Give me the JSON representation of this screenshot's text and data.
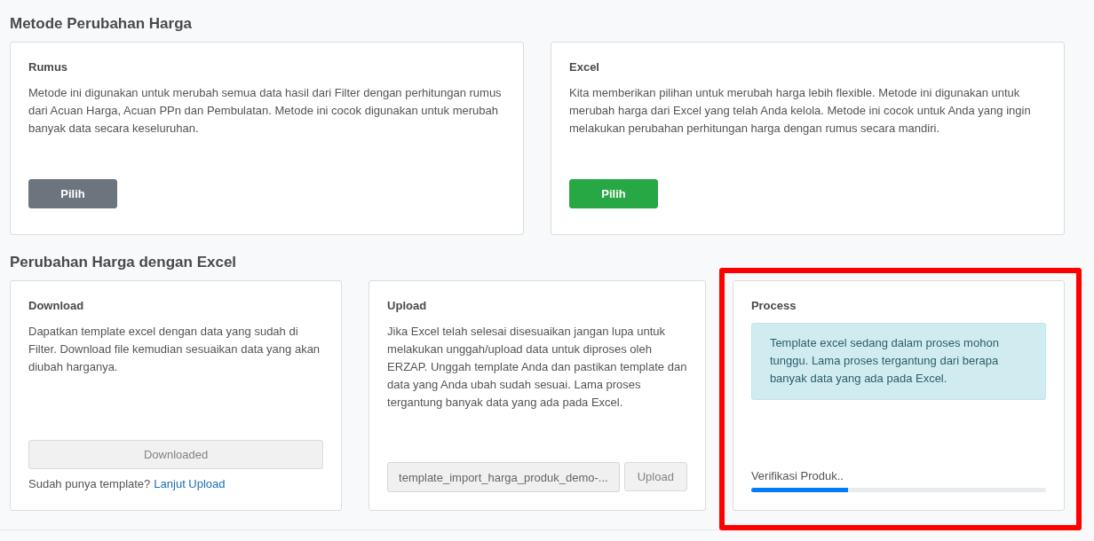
{
  "sections": [
    {
      "title": "Metode Perubahan Harga",
      "cards": [
        {
          "kind": "method",
          "title": "Rumus",
          "text": "Metode ini digunakan untuk merubah semua data hasil dari Filter dengan perhitungan rumus dari Acuan Harga, Acuan PPn dan Pembulatan. Metode ini cocok digunakan untuk merubah banyak data secara keseluruhan.",
          "button": {
            "label": "Pilih",
            "disabled": false
          }
        },
        {
          "kind": "method",
          "title": "Excel",
          "text": "Kita memberikan pilihan untuk merubah harga lebih flexible. Metode ini digunakan untuk merubah harga dari Excel yang telah Anda kelola. Metode ini cocok untuk Anda yang ingin melakukan perubahan perhitungan harga dengan rumus secara mandiri.",
          "button": {
            "label": "Pilih",
            "disabled": false
          }
        }
      ]
    },
    {
      "title": "Perubahan Harga dengan Excel",
      "cards": [
        {
          "kind": "download",
          "title": "Download",
          "text": "Dapatkan template excel dengan data yang sudah di Filter. Download file kemudian sesuaikan data yang akan diubah harganya.",
          "button": {
            "label": "Downloaded",
            "disabled": true
          },
          "footer": {
            "text": "Sudah punya template?",
            "link": "Lanjut Upload"
          }
        },
        {
          "kind": "upload",
          "title": "Upload",
          "text": "Jika Excel telah selesai disesuaikan jangan lupa untuk melakukan unggah/upload data untuk diproses oleh ERZAP. Unggah template Anda dan pastikan template dan data yang Anda ubah sudah sesuai. Lama proses tergantung banyak data yang ada pada Excel.",
          "file_field": {
            "value": "template_import_harga_produk_demo-..."
          },
          "button": {
            "label": "Upload",
            "disabled": true
          }
        },
        {
          "kind": "process",
          "highlighted": true,
          "title": "Process",
          "alert": "Template excel sedang dalam proses mohon tunggu. Lama proses tergantung dari berapa banyak data yang ada pada Excel.",
          "progress": {
            "label": "Verifikasi Produk..",
            "level": 0.33
          }
        }
      ]
    }
  ]
}
